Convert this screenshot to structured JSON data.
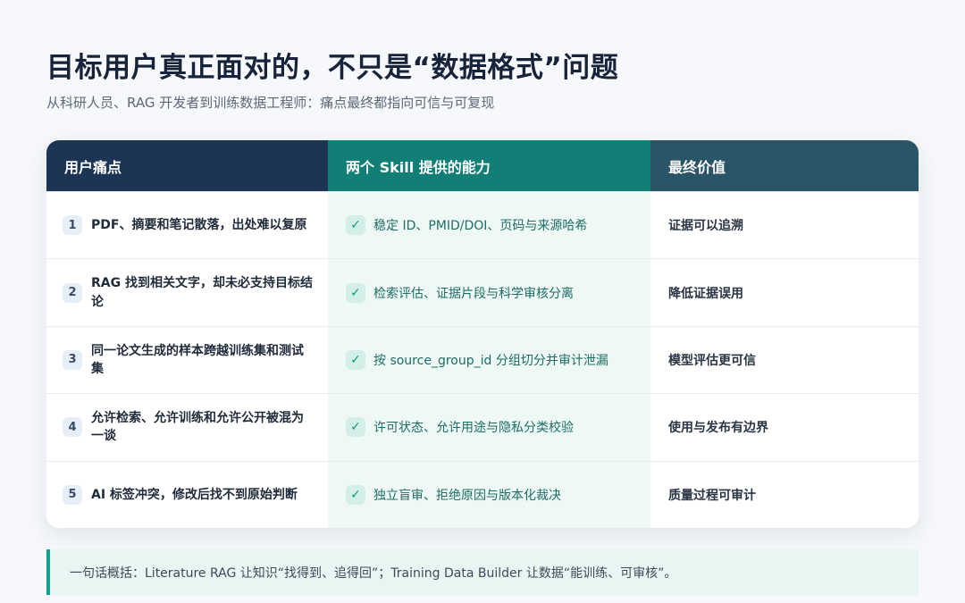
{
  "title": "目标用户真正面对的，不只是“数据格式”问题",
  "subtitle": "从科研人员、RAG 开发者到训练数据工程师：痛点最终都指向可信与可复现",
  "table": {
    "headers": [
      "用户痛点",
      "两个 Skill 提供的能力",
      "最终价值"
    ],
    "rows": [
      {
        "num": "1",
        "pain": "PDF、摘要和笔记散落，出处难以复原",
        "check": "✓",
        "capability": "稳定 ID、PMID/DOI、页码与来源哈希",
        "value": "证据可以追溯"
      },
      {
        "num": "2",
        "pain": "RAG 找到相关文字，却未必支持目标结论",
        "check": "✓",
        "capability": "检索评估、证据片段与科学审核分离",
        "value": "降低证据误用"
      },
      {
        "num": "3",
        "pain": "同一论文生成的样本跨越训练集和测试集",
        "check": "✓",
        "capability": "按 source_group_id 分组切分并审计泄漏",
        "value": "模型评估更可信"
      },
      {
        "num": "4",
        "pain": "允许检索、允许训练和允许公开被混为一谈",
        "check": "✓",
        "capability": "许可状态、允许用途与隐私分类校验",
        "value": "使用与发布有边界"
      },
      {
        "num": "5",
        "pain": "AI 标签冲突，修改后找不到原始判断",
        "check": "✓",
        "capability": "独立盲审、拒绝原因与版本化裁决",
        "value": "质量过程可审计"
      }
    ]
  },
  "summary": "一句话概括：Literature RAG 让知识“找得到、追得回”；Training Data Builder 让数据“能训练、可审核”。",
  "colors": {
    "header_pain": "#1c3554",
    "header_capability": "#127f76",
    "header_value": "#2a5566",
    "accent": "#14a08e"
  }
}
